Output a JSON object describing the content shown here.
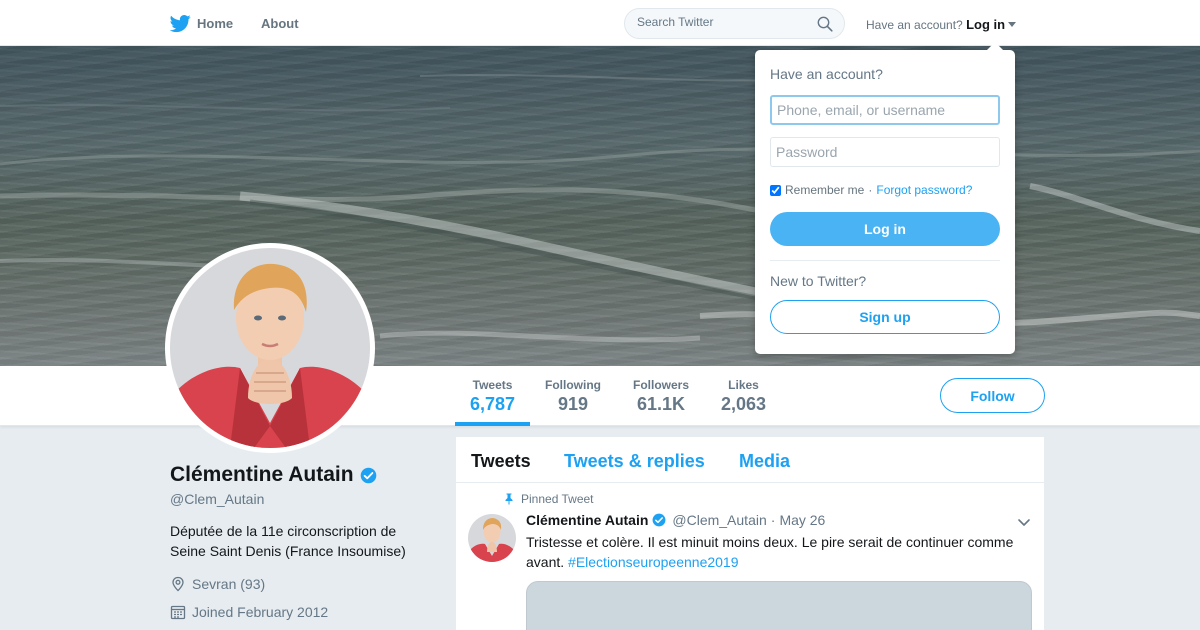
{
  "colors": {
    "brand": "#1da1f2",
    "login_button": "#4ab3f4",
    "secondary_text": "#657786"
  },
  "nav": {
    "home_label": "Home",
    "about_label": "About",
    "search_placeholder": "Search Twitter",
    "have_account": "Have an account?",
    "login_label": "Log in"
  },
  "login_dropdown": {
    "title": "Have an account?",
    "username_placeholder": "Phone, email, or username",
    "password_placeholder": "Password",
    "remember_label": "Remember me",
    "separator": "·",
    "forgot_label": "Forgot password?",
    "remember_checked": true,
    "login_button": "Log in",
    "new_prompt": "New to Twitter?",
    "signup_button": "Sign up"
  },
  "stats": [
    {
      "label": "Tweets",
      "value": "6,787",
      "active": true
    },
    {
      "label": "Following",
      "value": "919"
    },
    {
      "label": "Followers",
      "value": "61.1K"
    },
    {
      "label": "Likes",
      "value": "2,063"
    }
  ],
  "follow_button": "Follow",
  "profile": {
    "name": "Clémentine Autain",
    "verified": true,
    "handle": "@Clem_Autain",
    "bio": "Députée de la 11e circonscription de Seine Saint Denis (France Insoumise)",
    "location": "Sevran (93)",
    "joined": "Joined February 2012"
  },
  "timeline": {
    "tabs": [
      "Tweets",
      "Tweets & replies",
      "Media"
    ],
    "active_tab": "Tweets",
    "tweet": {
      "pinned_label": "Pinned Tweet",
      "name": "Clémentine Autain",
      "handle": "@Clem_Autain",
      "separator": "·",
      "date": "May 26",
      "text": "Tristesse et colère. Il est minuit moins deux. Le pire serait de continuer comme avant. ",
      "hashtag": "#Electionseuropeenne2019"
    }
  },
  "icons": {
    "logo": "twitter-bird-icon",
    "search": "magnifier-icon",
    "verified": "verified-badge-icon",
    "location": "map-pin-icon",
    "joined": "calendar-icon",
    "pin": "pushpin-icon",
    "tweet_menu": "chevron-down-icon"
  }
}
